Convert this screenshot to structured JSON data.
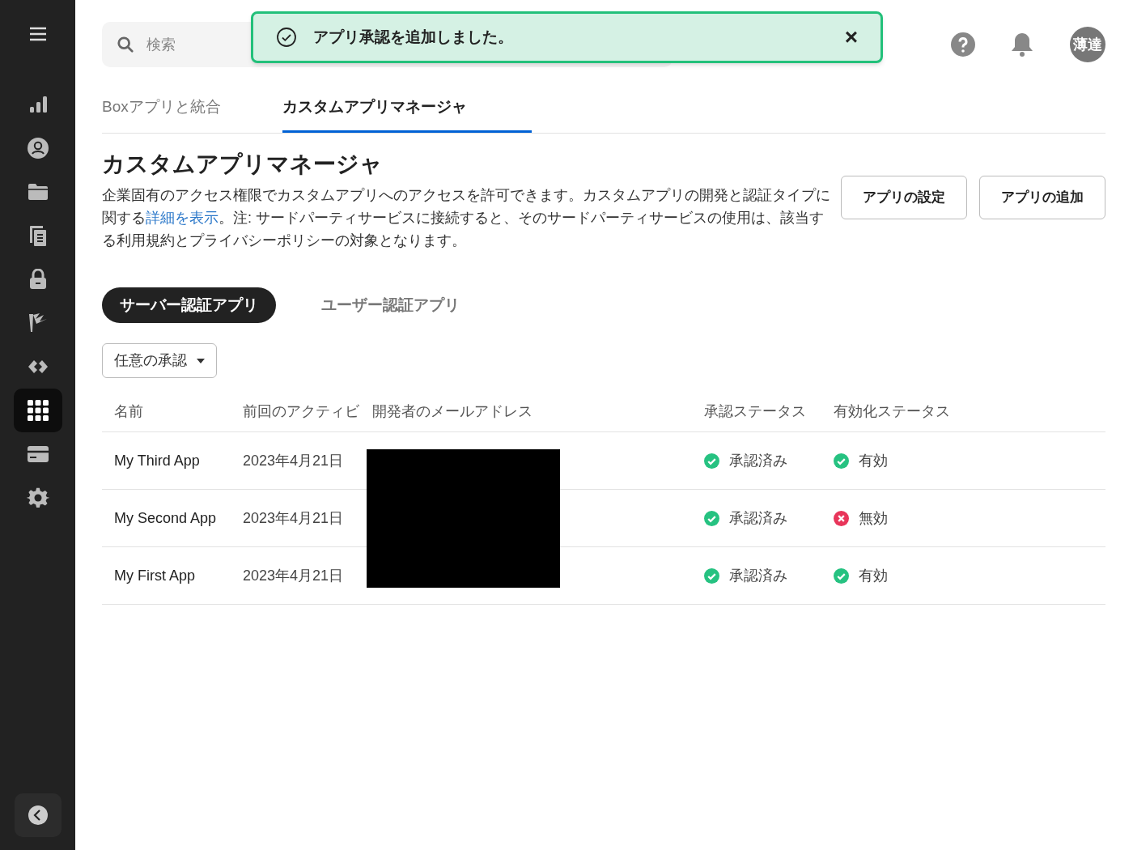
{
  "sidebar": {
    "items": [
      {
        "selected": false
      },
      {
        "selected": false
      },
      {
        "selected": false
      },
      {
        "selected": false
      },
      {
        "selected": false
      },
      {
        "selected": false
      },
      {
        "selected": false
      },
      {
        "selected": true
      },
      {
        "selected": false
      },
      {
        "selected": false
      }
    ]
  },
  "search": {
    "placeholder": "検索"
  },
  "toast": {
    "message": "アプリ承認を追加しました。",
    "close": "×"
  },
  "header": {
    "avatar": "薄達"
  },
  "tabs": [
    {
      "label": "Boxアプリと統合",
      "selected": false
    },
    {
      "label": "カスタムアプリマネージャ",
      "selected": true
    }
  ],
  "page": {
    "title": "カスタムアプリマネージャ",
    "description_before": "企業固有のアクセス権限でカスタムアプリへのアクセスを許可できます。カスタムアプリの開発と認証タイプに関する",
    "description_link": "詳細を表示",
    "description_after": "。注: サードパーティサービスに接続すると、そのサードパーティサービスの使用は、該当する利用規約とプライバシーポリシーの対象となります。",
    "buttons": [
      "アプリの設定",
      "アプリの追加"
    ]
  },
  "app_tabs": [
    {
      "label": "サーバー認証アプリ",
      "selected": true
    },
    {
      "label": "ユーザー認証アプリ",
      "selected": false
    }
  ],
  "filter": {
    "value": "任意の承認"
  },
  "table": {
    "columns": [
      "名前",
      "前回のアクティビ",
      "開発者のメールアドレス",
      "承認ステータス",
      "有効化ステータス"
    ],
    "email_redacted": true,
    "rows": [
      {
        "name": "My Third App",
        "last_activity": "2023年4月21日",
        "approval": {
          "text": "承認済み",
          "ok": true
        },
        "activation": {
          "text": "有効",
          "ok": true
        }
      },
      {
        "name": "My Second App",
        "last_activity": "2023年4月21日",
        "approval": {
          "text": "承認済み",
          "ok": true
        },
        "activation": {
          "text": "無効",
          "ok": false
        }
      },
      {
        "name": "My First App",
        "last_activity": "2023年4月21日",
        "approval": {
          "text": "承認済み",
          "ok": true
        },
        "activation": {
          "text": "有効",
          "ok": true
        }
      }
    ]
  }
}
